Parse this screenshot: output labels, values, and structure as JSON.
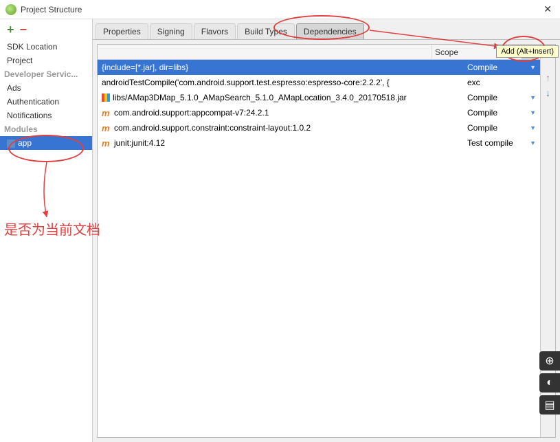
{
  "window": {
    "title": "Project Structure"
  },
  "sidebar": {
    "sections": [
      {
        "label": "SDK Location",
        "type": "item"
      },
      {
        "label": "Project",
        "type": "item"
      },
      {
        "label": "Developer Servic...",
        "type": "heading"
      },
      {
        "label": "Ads",
        "type": "item"
      },
      {
        "label": "Authentication",
        "type": "item"
      },
      {
        "label": "Notifications",
        "type": "item"
      },
      {
        "label": "Modules",
        "type": "heading"
      },
      {
        "label": "app",
        "type": "module",
        "selected": true
      }
    ]
  },
  "tabs": [
    {
      "label": "Properties"
    },
    {
      "label": "Signing"
    },
    {
      "label": "Flavors"
    },
    {
      "label": "Build Types"
    },
    {
      "label": "Dependencies",
      "active": true
    }
  ],
  "tooltip": "Add (Alt+Insert)",
  "dep_header": {
    "scope": "Scope"
  },
  "dependencies": [
    {
      "name": "{include=[*.jar], dir=libs}",
      "scope": "Compile",
      "icon": "none",
      "selected": true
    },
    {
      "name": "androidTestCompile('com.android.support.test.espresso:espresso-core:2.2.2', {",
      "scope": "exc",
      "icon": "none"
    },
    {
      "name": "libs/AMap3DMap_5.1.0_AMapSearch_5.1.0_AMapLocation_3.4.0_20170518.jar",
      "scope": "Compile",
      "icon": "jar"
    },
    {
      "name": "com.android.support:appcompat-v7:24.2.1",
      "scope": "Compile",
      "icon": "m"
    },
    {
      "name": "com.android.support.constraint:constraint-layout:1.0.2",
      "scope": "Compile",
      "icon": "m"
    },
    {
      "name": "junit:junit:4.12",
      "scope": "Test compile",
      "icon": "m"
    }
  ],
  "annotation": {
    "text": "是否为当前文档"
  }
}
